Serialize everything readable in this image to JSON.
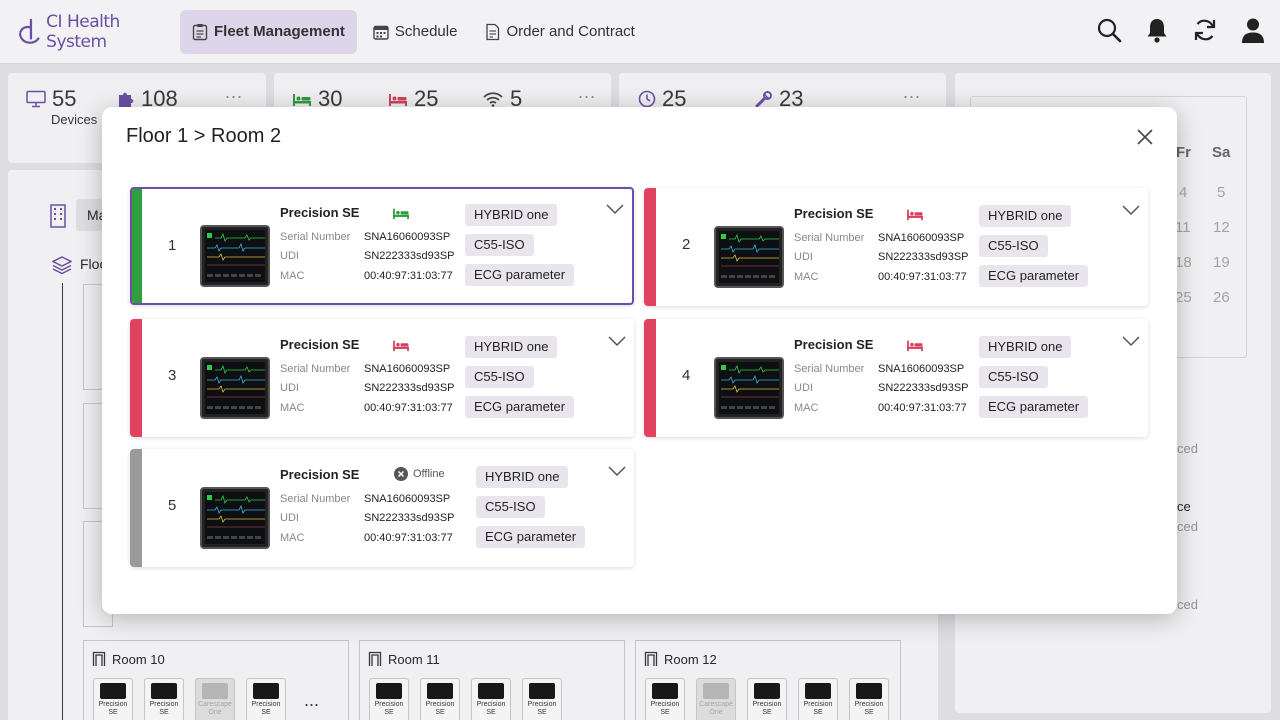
{
  "app": {
    "name": "CI Health System"
  },
  "nav": [
    {
      "label": "Fleet Management"
    },
    {
      "label": "Schedule"
    },
    {
      "label": "Order and Contract"
    }
  ],
  "stats": {
    "devices": "55",
    "devices_label": "Devices",
    "components": "108",
    "in_use": "30",
    "occupied": "25",
    "online": "5",
    "scheduled": "25",
    "maintenance": "23",
    "more": "..."
  },
  "background": {
    "left_tab": "Ma",
    "floor": "Floo",
    "calendar_headers": [
      "Fr",
      "Sa"
    ],
    "calendar_rows": [
      [
        "4",
        "5"
      ],
      [
        "11",
        "12"
      ],
      [
        "18",
        "19"
      ],
      [
        "25",
        "26"
      ]
    ],
    "right_texts": [
      "ced",
      "ce",
      "ced",
      "ced"
    ],
    "rooms": [
      {
        "title": "Room 10",
        "devices": [
          {
            "l1": "Precision",
            "l2": "SE",
            "dim": false
          },
          {
            "l1": "Precision",
            "l2": "SE",
            "dim": false
          },
          {
            "l1": "Carescape",
            "l2": "One",
            "dim": true
          },
          {
            "l1": "Precision",
            "l2": "SE",
            "dim": false
          }
        ]
      },
      {
        "title": "Room 11",
        "devices": [
          {
            "l1": "Precision",
            "l2": "SE",
            "dim": false
          },
          {
            "l1": "Precision",
            "l2": "SE",
            "dim": false
          },
          {
            "l1": "Precision",
            "l2": "SE",
            "dim": false
          },
          {
            "l1": "Precision",
            "l2": "SE",
            "dim": false
          }
        ]
      },
      {
        "title": "Room 12",
        "devices": [
          {
            "l1": "Precision",
            "l2": "SE",
            "dim": false
          },
          {
            "l1": "Carescape",
            "l2": "One",
            "dim": true
          },
          {
            "l1": "Precision",
            "l2": "SE",
            "dim": false
          },
          {
            "l1": "Precision",
            "l2": "SE",
            "dim": false
          },
          {
            "l1": "Precision",
            "l2": "SE",
            "dim": false
          }
        ]
      }
    ],
    "more": "..."
  },
  "modal": {
    "title": "Floor 1 > Room 2",
    "labels": {
      "serial": "Serial Number",
      "udi": "UDI",
      "mac": "MAC"
    },
    "devices": [
      {
        "num": "1",
        "name": "Precision SE",
        "status": "available",
        "status_color": "#2e9e3e",
        "bar_color": "#2e9e3e",
        "selected": true,
        "serial": "SNA16060093SP",
        "udi": "SN222333sd93SP",
        "mac": "00:40:97:31:03:77",
        "tags": [
          "HYBRID one",
          "C55-ISO",
          "ECG parameter"
        ]
      },
      {
        "num": "2",
        "name": "Precision SE",
        "status": "occupied",
        "status_color": "#d6405e",
        "bar_color": "#e0435f",
        "selected": false,
        "serial": "SNA16060093SP",
        "udi": "SN222333sd93SP",
        "mac": "00:40:97:31:03:77",
        "tags": [
          "HYBRID one",
          "C55-ISO",
          "ECG parameter"
        ]
      },
      {
        "num": "3",
        "name": "Precision SE",
        "status": "occupied",
        "status_color": "#d6405e",
        "bar_color": "#e0435f",
        "selected": false,
        "serial": "SNA16060093SP",
        "udi": "SN222333sd93SP",
        "mac": "00:40:97:31:03:77",
        "tags": [
          "HYBRID one",
          "C55-ISO",
          "ECG parameter"
        ]
      },
      {
        "num": "4",
        "name": "Precision SE",
        "status": "occupied",
        "status_color": "#d6405e",
        "bar_color": "#e0435f",
        "selected": false,
        "serial": "SNA16060093SP",
        "udi": "SN222333sd93SP",
        "mac": "00:40:97:31:03:77",
        "tags": [
          "HYBRID one",
          "C55-ISO",
          "ECG parameter"
        ]
      },
      {
        "num": "5",
        "name": "Precision SE",
        "status": "offline",
        "status_label": "Offline",
        "status_color": "#555555",
        "bar_color": "#9a9a9a",
        "selected": false,
        "serial": "SNA16060093SP",
        "udi": "SN222333sd93SP",
        "mac": "00:40:97:31:03:77",
        "tags": [
          "HYBRID one",
          "C55-ISO",
          "ECG parameter"
        ]
      }
    ]
  }
}
